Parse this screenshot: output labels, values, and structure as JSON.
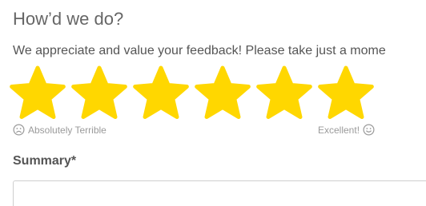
{
  "form": {
    "title": "How’d we do?",
    "intro": "We appreciate and value your feedback! Please take just a mome",
    "rating": {
      "value": 6,
      "max": 6,
      "star_color": "#FFD700",
      "low_label": "Absolutely Terrible",
      "high_label": "Excellent!",
      "low_icon": "frown-face-icon",
      "high_icon": "smile-face-icon",
      "label_color": "#9a9a9a"
    },
    "summary": {
      "label": "Summary*",
      "value": "",
      "placeholder": ""
    }
  }
}
